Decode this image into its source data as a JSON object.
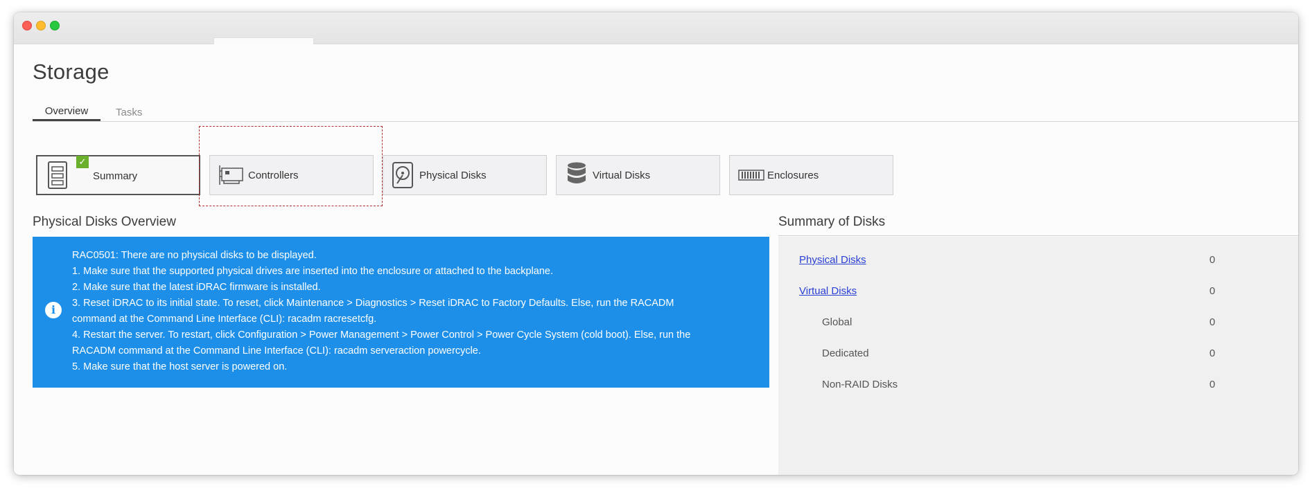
{
  "page": {
    "title": "Storage",
    "tabs": [
      {
        "label": "Overview",
        "active": true
      },
      {
        "label": "Tasks",
        "active": false
      }
    ]
  },
  "nav_cards": [
    {
      "label": "Summary",
      "icon": "server-list-icon",
      "selected": true
    },
    {
      "label": "Controllers",
      "icon": "controller-card-icon",
      "selected": false
    },
    {
      "label": "Physical Disks",
      "icon": "hard-disk-icon",
      "selected": false
    },
    {
      "label": "Virtual Disks",
      "icon": "database-stack-icon",
      "selected": false
    },
    {
      "label": "Enclosures",
      "icon": "enclosure-icon",
      "selected": false
    }
  ],
  "physical_overview": {
    "title": "Physical Disks Overview",
    "alert_lines": [
      "RAC0501: There are no physical disks to be displayed.",
      "1. Make sure that the supported physical drives are inserted into the enclosure or attached to the backplane.",
      "2. Make sure that the latest iDRAC firmware is installed.",
      "3. Reset iDRAC to its initial state. To reset, click Maintenance > Diagnostics > Reset iDRAC to Factory Defaults. Else, run the RACADM",
      "command at the Command Line Interface (CLI): racadm racresetcfg.",
      "4. Restart the server. To restart, click Configuration > Power Management > Power Control > Power Cycle System (cold boot). Else, run the",
      "RACADM command at the Command Line Interface (CLI): racadm serveraction powercycle.",
      "5. Make sure that the host server is powered on."
    ]
  },
  "summary_of_disks": {
    "title": "Summary of Disks",
    "rows": [
      {
        "label": "Physical Disks",
        "value": "0",
        "link": true
      },
      {
        "label": "Virtual Disks",
        "value": "0",
        "link": true
      },
      {
        "label": "Global",
        "value": "0",
        "link": false
      },
      {
        "label": "Dedicated",
        "value": "0",
        "link": false
      },
      {
        "label": "Non-RAID Disks",
        "value": "0",
        "link": false
      }
    ]
  },
  "colors": {
    "alert_bg": "#1d8fe8",
    "link": "#2a3fd6",
    "check_badge": "#6ab02c",
    "highlight_border": "#b03030"
  }
}
